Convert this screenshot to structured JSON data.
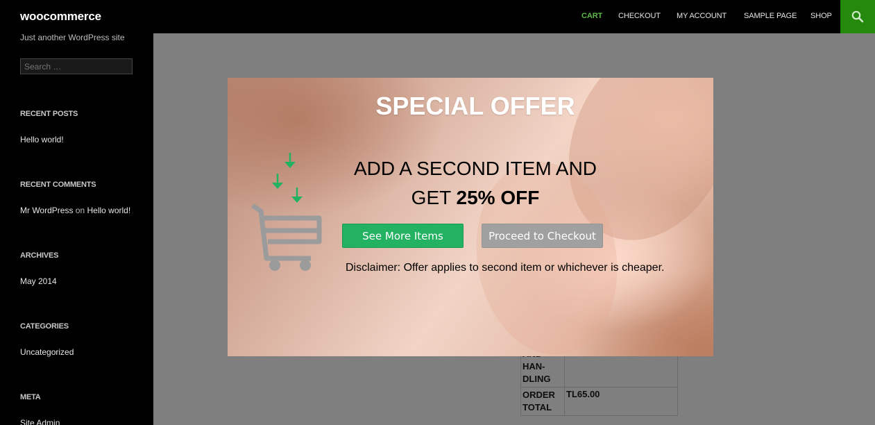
{
  "site": {
    "title": "woocommerce",
    "description": "Just another WordPress site"
  },
  "sidebar": {
    "search_placeholder": "Search …",
    "widgets": {
      "recent_posts": {
        "title": "RECENT POSTS",
        "item": "Hello world!"
      },
      "recent_comments": {
        "title": "RECENT COMMENTS",
        "author": "Mr WordPress",
        "on": "on",
        "post": "Hello world!"
      },
      "archives": {
        "title": "ARCHIVES",
        "item": "May 2014"
      },
      "categories": {
        "title": "CATEGORIES",
        "item": "Uncategorized"
      },
      "meta": {
        "title": "META",
        "item": "Site Admin"
      }
    }
  },
  "nav": {
    "items": [
      "CART",
      "CHECKOUT",
      "MY ACCOUNT",
      "SAMPLE PAGE",
      "SHOP"
    ],
    "active": "CART",
    "search_icon": "search-icon",
    "accent_color": "#24890d"
  },
  "totals": {
    "shipping_label_lines": [
      "AND",
      "HAN-",
      "DLING"
    ],
    "order_total_label_lines": [
      "ORDER",
      "TOTAL"
    ],
    "order_total_value": "TL65.00"
  },
  "modal": {
    "title": "SPECIAL OFFER",
    "headline_line1": "ADD A SECOND ITEM AND",
    "headline_prefix": "GET ",
    "headline_bold": "25% OFF",
    "primary_button": "See More Items",
    "secondary_button": "Proceed to Checkout",
    "disclaimer": "Disclaimer: Offer applies to second item or whichever is cheaper.",
    "colors": {
      "primary": "#22b262",
      "secondary": "#a0a0a0",
      "arrow": "#22b262"
    },
    "icon": "cart-icon"
  }
}
